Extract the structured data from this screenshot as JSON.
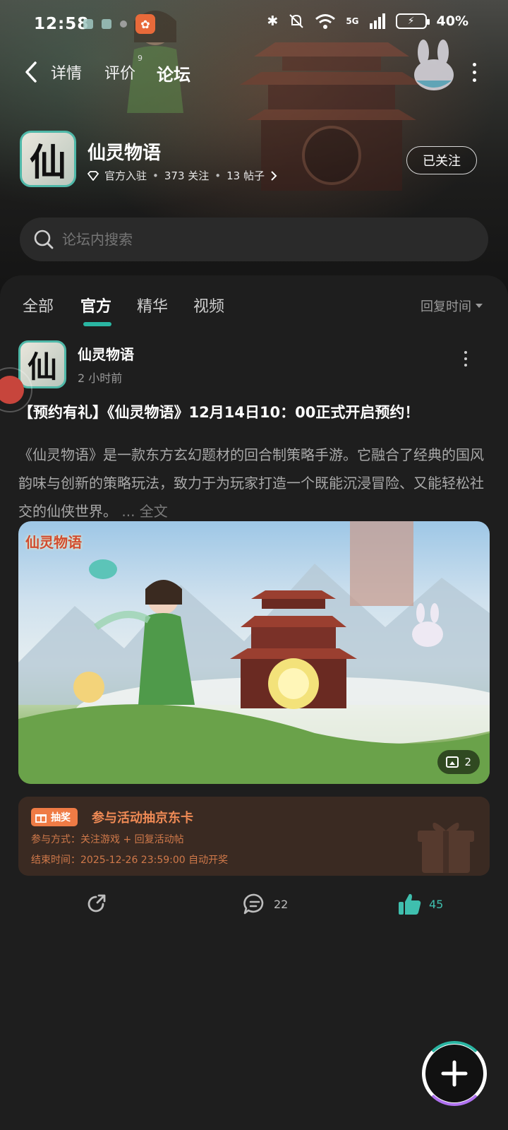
{
  "status_bar": {
    "time": "12:58",
    "battery": "40%",
    "network": "5G"
  },
  "nav": {
    "tabs": [
      {
        "label": "详情"
      },
      {
        "label": "评价",
        "superscript": "9"
      },
      {
        "label": "论坛"
      }
    ],
    "active_tab": "论坛"
  },
  "game": {
    "icon_glyph": "仙",
    "name": "仙灵物语",
    "official_badge": "官方入驻",
    "followers": "373 关注",
    "posts": "13 帖子",
    "follow_button": "已关注"
  },
  "search": {
    "placeholder": "论坛内搜索"
  },
  "filters": {
    "tabs": [
      "全部",
      "官方",
      "精华",
      "视频"
    ],
    "active": "官方",
    "sort_label": "回复时间"
  },
  "post": {
    "author": "仙灵物语",
    "author_glyph": "仙",
    "time": "2 小时前",
    "title": "【预约有礼】《仙灵物语》12月14日10：00正式开启预约！",
    "body": "《仙灵物语》是一款东方玄幻题材的回合制策略手游。它融合了经典的国风韵味与创新的策略玩法，致力于为玩家打造一个既能沉浸冒险、又能轻松社交的仙侠世界。",
    "full_text_link": "... 全文",
    "image_logo_text": "仙灵物语",
    "image_count": "2",
    "lottery": {
      "badge": "抽奖",
      "title": "参与活动抽京东卡",
      "method": "参与方式：关注游戏 + 回复活动帖",
      "end_time": "结束时间：2025-12-26 23:59:00 自动开奖"
    },
    "comments": "22",
    "likes": "45"
  },
  "colors": {
    "accent": "#2ab6a3",
    "lottery_orange": "#ef7b45",
    "background": "#1e1e1e"
  }
}
